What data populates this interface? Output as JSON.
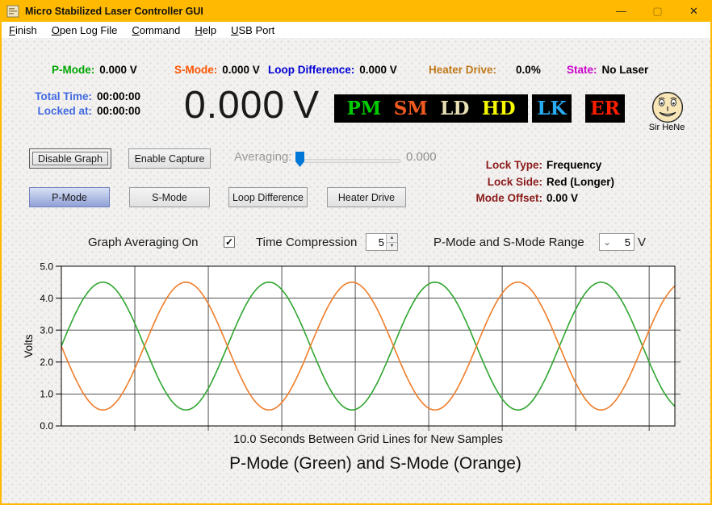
{
  "window": {
    "title": "Micro Stabilized Laser Controller GUI",
    "icons": {
      "minimize": "—",
      "maximize": "▢",
      "close": "✕"
    },
    "theme": {
      "titlebar": "#FFB900",
      "border": "#FFB900",
      "background": "#F2F1EF"
    }
  },
  "menu": {
    "items": [
      "Finish",
      "Open Log File",
      "Command",
      "Help",
      "USB Port"
    ]
  },
  "status_row": {
    "items": [
      {
        "label": "P-Mode:",
        "value": "0.000 V",
        "color": "#00A800"
      },
      {
        "label": "S-Mode:",
        "value": "0.000 V",
        "color": "#FF5400"
      },
      {
        "label": "Loop Difference:",
        "value": "0.000 V",
        "color": "#0000D4"
      },
      {
        "label": "Heater Drive:",
        "value": "0.0%",
        "color": "#C07818"
      },
      {
        "label": "State:",
        "value": "No Laser",
        "color": "#CC00CC"
      }
    ]
  },
  "timers": {
    "label_color": "#4169E1",
    "rows": [
      {
        "label": "Total Time:",
        "value": "00:00:00"
      },
      {
        "label": "Locked at:",
        "value": "00:00:00"
      }
    ]
  },
  "main_display": {
    "value": "0.000",
    "unit": "V"
  },
  "indicators": {
    "group1": [
      {
        "label": "PM",
        "color": "#00CC00"
      },
      {
        "label": "SM",
        "color": "#F05A1E"
      },
      {
        "label": "LD",
        "color": "#E8E0B4"
      },
      {
        "label": "HD",
        "color": "#F8F800"
      }
    ],
    "group2": [
      {
        "label": "LK",
        "color": "#29ABF2"
      }
    ],
    "group3": [
      {
        "label": "ER",
        "color": "#FF1E00"
      }
    ]
  },
  "mascot": {
    "label": "Sir HeNe"
  },
  "controls": {
    "disable_graph": "Disable Graph",
    "enable_capture": "Enable Capture",
    "averaging_label": "Averaging:",
    "averaging_value": "0.000",
    "mode_buttons": [
      {
        "label": "P-Mode",
        "selected": true
      },
      {
        "label": "S-Mode",
        "selected": false
      },
      {
        "label": "Loop Difference",
        "selected": false
      },
      {
        "label": "Heater Drive",
        "selected": false
      }
    ],
    "graph_averaging_label": "Graph Averaging On",
    "graph_averaging_checked": true,
    "time_compression_label": "Time Compression",
    "time_compression_value": "5",
    "range_label": "P-Mode and S-Mode Range",
    "range_value": "5",
    "range_unit": "V"
  },
  "lock_info": {
    "label_color": "#8B1A1A",
    "rows": [
      {
        "label": "Lock Type:",
        "value": "Frequency"
      },
      {
        "label": "Lock Side:",
        "value": "Red (Longer)"
      },
      {
        "label": "Mode Offset:",
        "value": "0.00 V"
      }
    ]
  },
  "icons": {
    "check": "✓",
    "spin_up": "▲",
    "spin_down": "▼",
    "combo_chevron": "⌄"
  },
  "chart_data": {
    "type": "line",
    "title": "P-Mode (Green) and S-Mode (Orange)",
    "xlabel": "10.0 Seconds Between Grid Lines for New Samples",
    "ylabel": "Volts",
    "ylim": [
      0.0,
      5.0
    ],
    "yticks": [
      "0.0",
      "1.0",
      "2.0",
      "3.0",
      "4.0",
      "5.0"
    ],
    "x_range_seconds": [
      0,
      83.5
    ],
    "grid_seconds": 10,
    "grid_on": true,
    "series": [
      {
        "name": "P-Mode",
        "color": "#2FA52F",
        "waveform": "sine",
        "center_volts": 2.5,
        "amplitude_volts": 2.0,
        "period_seconds": 22.6,
        "phase_degrees": 0
      },
      {
        "name": "S-Mode",
        "color": "#EF7D2A",
        "waveform": "sine",
        "center_volts": 2.5,
        "amplitude_volts": 2.0,
        "period_seconds": 22.6,
        "phase_degrees": 180
      }
    ]
  }
}
